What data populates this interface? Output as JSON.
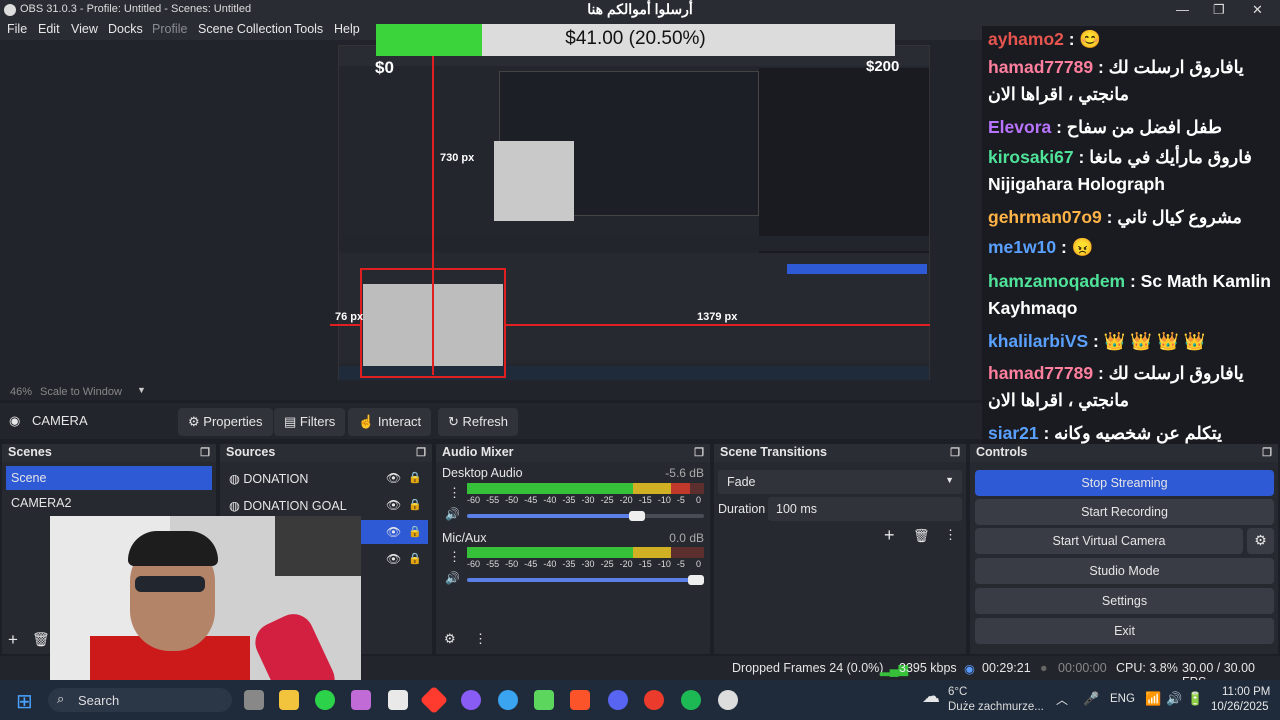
{
  "window": {
    "title": "OBS 31.0.3 - Profile: Untitled - Scenes: Untitled"
  },
  "menu": {
    "items": [
      "File",
      "Edit",
      "View",
      "Docks",
      "Profile",
      "Scene Collection",
      "Tools",
      "Help"
    ]
  },
  "donation": {
    "top_text": "أرسلوا أموالكم هنا",
    "bar_text": "$41.00 (20.50%)",
    "progress": 0.205,
    "min": "$0",
    "max": "$200"
  },
  "overlay": {
    "h_label": "730 px",
    "left_label": "76 px",
    "right_label": "1379 px"
  },
  "chat": [
    {
      "user": "ayhamo2",
      "msg": " : 😊",
      "color": "#e8554f"
    },
    {
      "user": "hamad77789",
      "msg": " : يافاروق ارسلت لك مانجتي ، اقراها الان",
      "color": "#ff7f9e"
    },
    {
      "user": "Elevora",
      "msg": " : طفل افضل من سفاح",
      "color": "#b874ff"
    },
    {
      "user": "kirosaki67",
      "msg": " : فاروق مارأيك في مانغا Nijigahara Holograph",
      "color": "#4fe39a"
    },
    {
      "user": "gehrman07o9",
      "msg": " : مشروع كيال ثاني",
      "color": "#ffb347"
    },
    {
      "user": "me1w10",
      "msg": " : 😠",
      "color": "#5aa0ff"
    },
    {
      "user": "hamzamoqadem",
      "msg": " : Sc Math Kamlin Kayhmaqo",
      "color": "#4fe39a"
    },
    {
      "user": "khalilarbiVS",
      "msg": " : 👑 👑 👑 👑",
      "color": "#5aa0ff"
    },
    {
      "user": "hamad77789",
      "msg": " : يافاروق ارسلت لك مانجتي ، اقراها الان",
      "color": "#ff7f9e"
    },
    {
      "user": "siar21",
      "msg": " : يتكلم عن شخصيه وكانه حقيقيه",
      "color": "#5aa0ff"
    }
  ],
  "scale": {
    "zoom": "46%",
    "mode": "Scale to Window"
  },
  "source_toolbar": {
    "name": "CAMERA",
    "properties": "Properties",
    "filters": "Filters",
    "interact": "Interact",
    "refresh": "Refresh"
  },
  "scenes": {
    "title": "Scenes",
    "items": [
      "Scene",
      "CAMERA2"
    ]
  },
  "sources": {
    "title": "Sources",
    "items": [
      "DONATION",
      "DONATION GOAL"
    ]
  },
  "mixer": {
    "title": "Audio Mixer",
    "channels": [
      {
        "name": "Desktop Audio",
        "db": "-5.6 dB",
        "level": 0.94,
        "volume": 0.75
      },
      {
        "name": "Mic/Aux",
        "db": "0.0 dB",
        "level": 0.86,
        "volume": 1.0
      }
    ],
    "ticks": [
      "-60",
      "-55",
      "-50",
      "-45",
      "-40",
      "-35",
      "-30",
      "-25",
      "-20",
      "-15",
      "-10",
      "-5",
      "0"
    ]
  },
  "transitions": {
    "title": "Scene Transitions",
    "selected": "Fade",
    "duration_label": "Duration",
    "duration": "100 ms"
  },
  "controls": {
    "title": "Controls",
    "stop_streaming": "Stop Streaming",
    "start_recording": "Start Recording",
    "start_virtual_camera": "Start Virtual Camera",
    "studio_mode": "Studio Mode",
    "settings": "Settings",
    "exit": "Exit"
  },
  "status": {
    "dropped": "Dropped Frames 24 (0.0%)",
    "kbps": "3395 kbps",
    "live_time": "00:29:21",
    "rec_time": "00:00:00",
    "cpu": "CPU: 3.8%",
    "fps": "30.00 / 30.00 FPS"
  },
  "taskbar": {
    "search": "Search",
    "weather_temp": "6°C",
    "weather_desc": "Duże zachmurze...",
    "lang": "ENG",
    "time": "11:00 PM",
    "date": "10/26/2025"
  },
  "colors": {
    "accent": "#2f5ad6",
    "meter_green": "#37c03a",
    "meter_yellow": "#d2b024",
    "meter_red": "#c0392b"
  }
}
